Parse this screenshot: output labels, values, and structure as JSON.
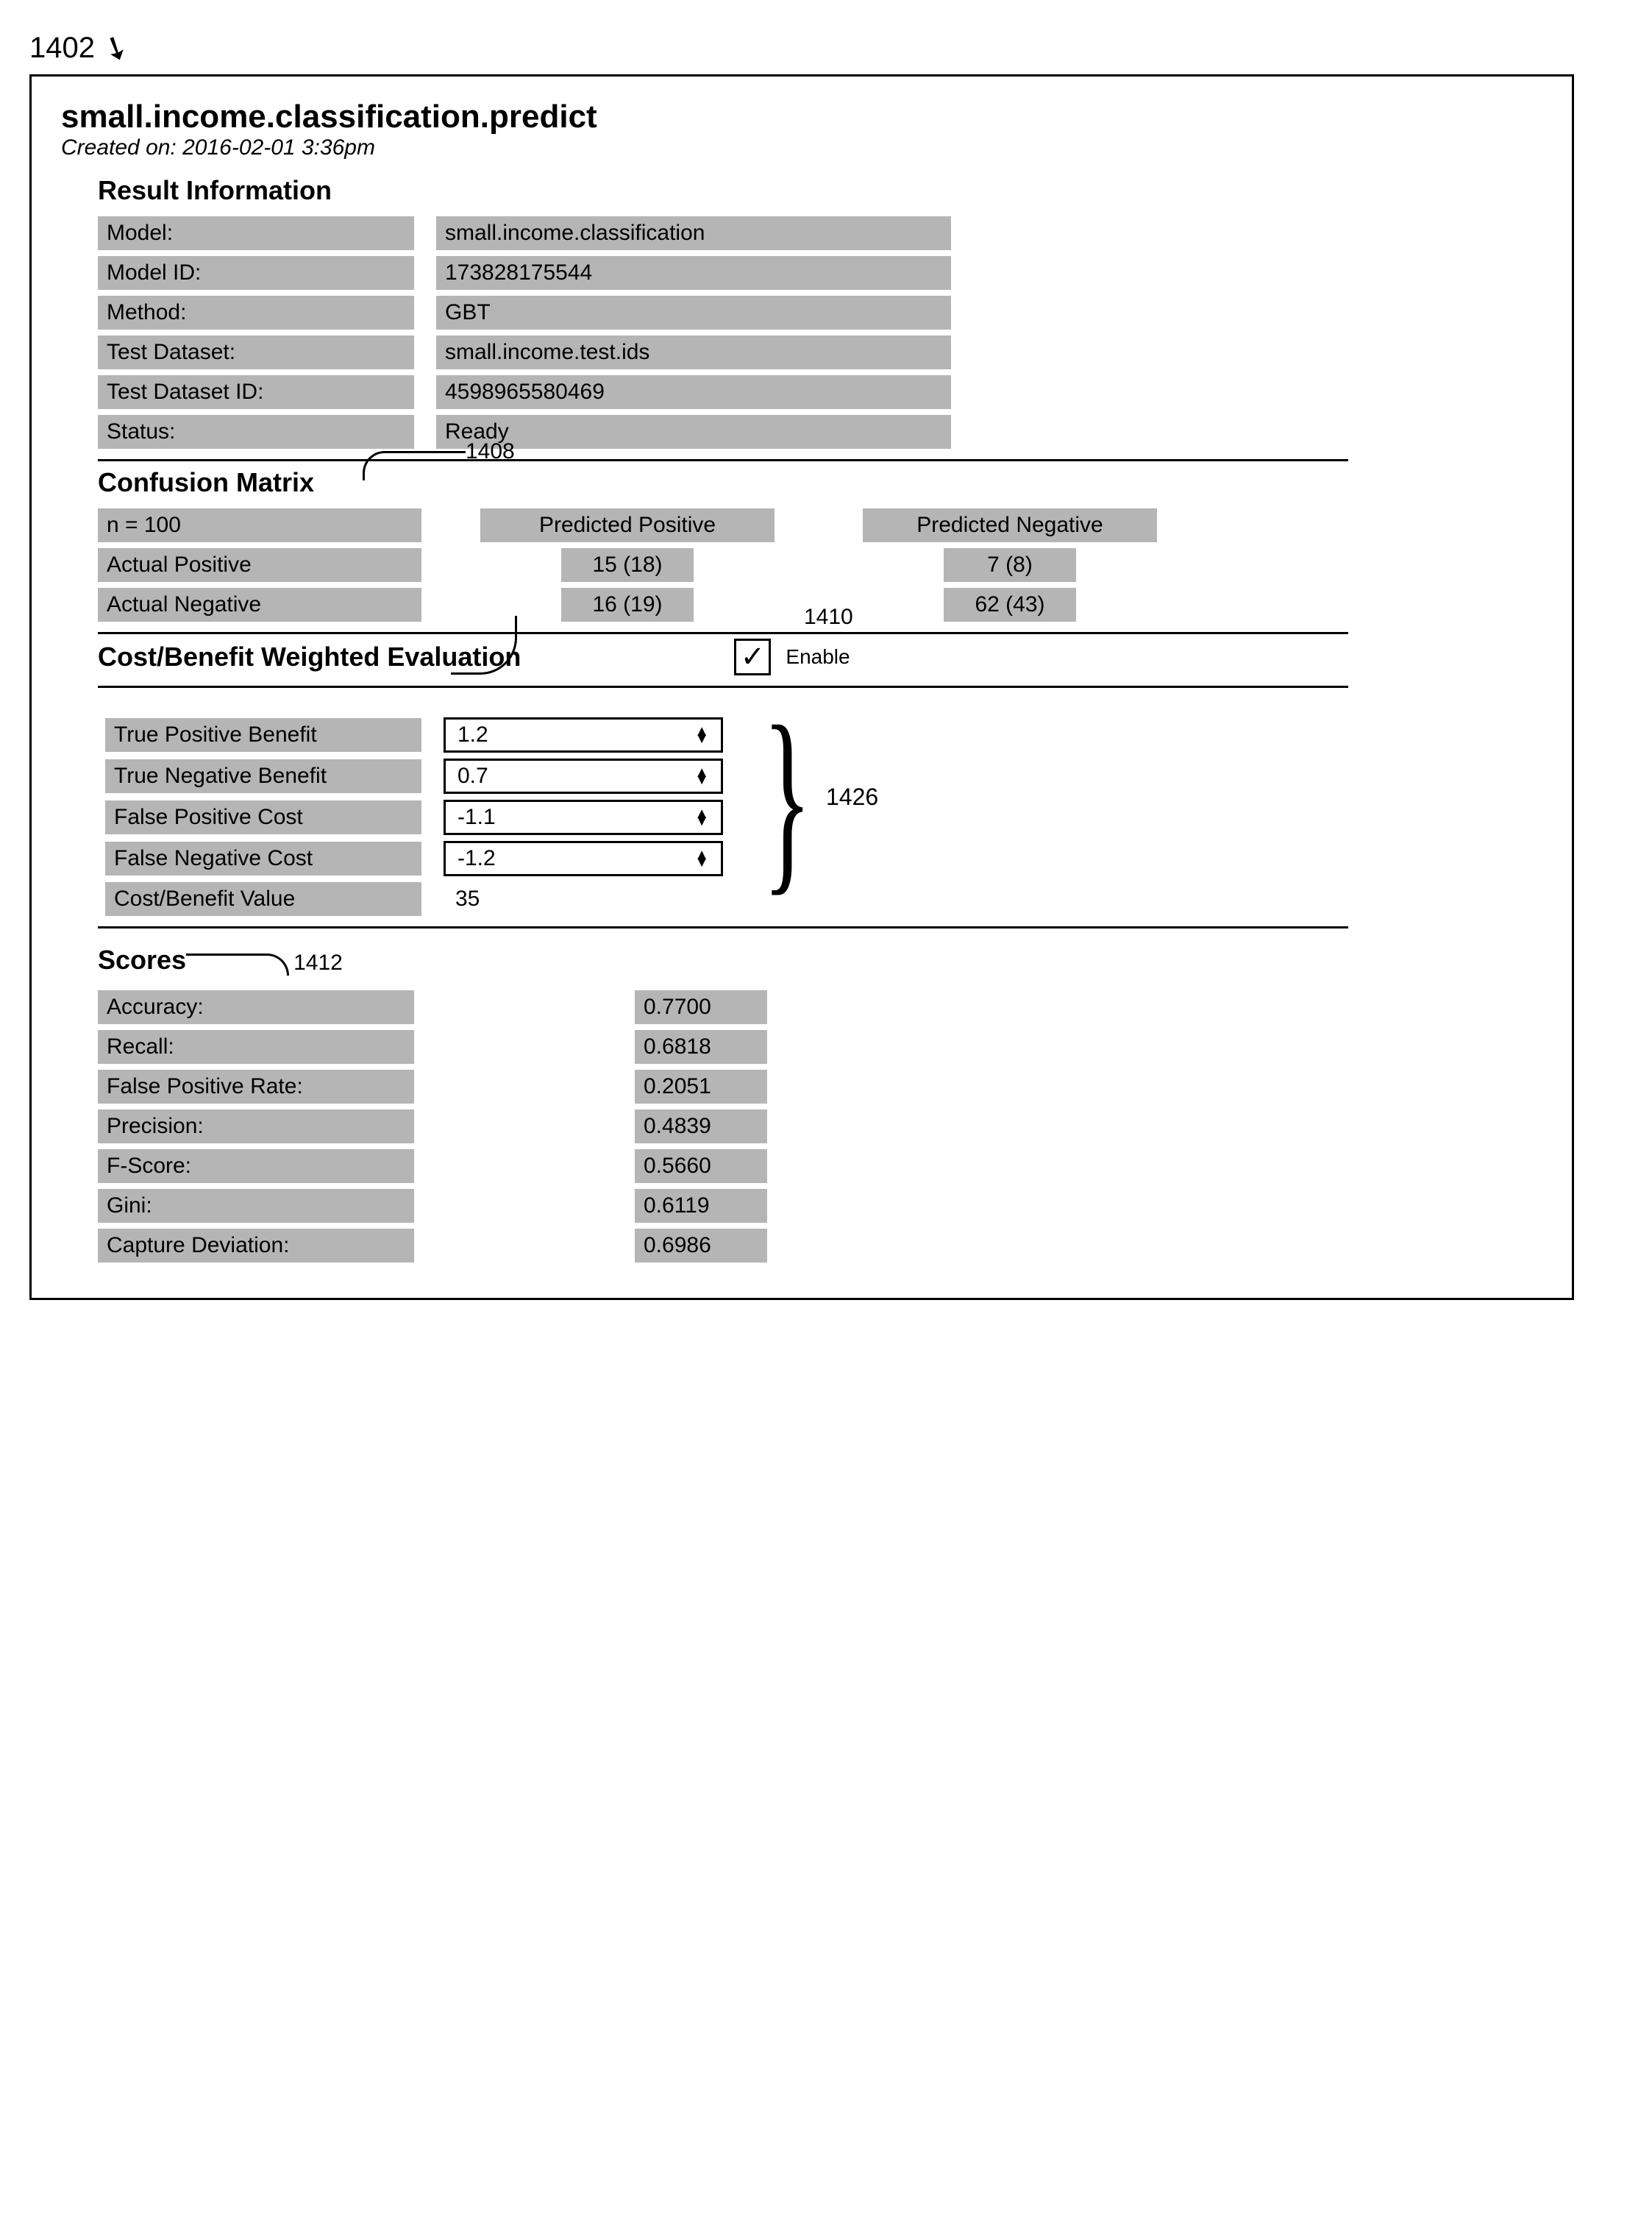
{
  "figure_ref": "1402",
  "header": {
    "title": "small.income.classification.predict",
    "created_label": "Created on:",
    "created_value": "2016-02-01 3:36pm"
  },
  "result_info": {
    "title": "Result Information",
    "rows": [
      {
        "label": "Model:",
        "value": "small.income.classification"
      },
      {
        "label": "Model ID:",
        "value": "173828175544"
      },
      {
        "label": "Method:",
        "value": "GBT"
      },
      {
        "label": "Test Dataset:",
        "value": "small.income.test.ids"
      },
      {
        "label": "Test Dataset ID:",
        "value": "4598965580469"
      },
      {
        "label": "Status:",
        "value": "Ready"
      }
    ]
  },
  "confusion_matrix": {
    "title": "Confusion Matrix",
    "callout": "1408",
    "n_label": "n = 100",
    "col_pos": "Predicted Positive",
    "col_neg": "Predicted Negative",
    "row_pos_label": "Actual Positive",
    "row_neg_label": "Actual Negative",
    "tp": "15 (18)",
    "fn": "7 (8)",
    "fp": "16 (19)",
    "tn": "62 (43)",
    "row_callout": "1410"
  },
  "cost_benefit": {
    "title": "Cost/Benefit Weighted Evaluation",
    "enable_label": "Enable",
    "enable_checked": true,
    "callout": "1426",
    "rows": [
      {
        "label": "True Positive Benefit",
        "value": "1.2"
      },
      {
        "label": "True Negative Benefit",
        "value": "0.7"
      },
      {
        "label": "False Positive Cost",
        "value": "-1.1"
      },
      {
        "label": "False Negative Cost",
        "value": "-1.2"
      }
    ],
    "result_label": "Cost/Benefit Value",
    "result_value": "35"
  },
  "scores": {
    "title": "Scores",
    "callout": "1412",
    "rows": [
      {
        "label": "Accuracy:",
        "value": "0.7700"
      },
      {
        "label": "Recall:",
        "value": "0.6818"
      },
      {
        "label": "False Positive Rate:",
        "value": "0.2051"
      },
      {
        "label": "Precision:",
        "value": "0.4839"
      },
      {
        "label": "F-Score:",
        "value": "0.5660"
      },
      {
        "label": "Gini:",
        "value": "0.6119"
      },
      {
        "label": "Capture Deviation:",
        "value": "0.6986"
      }
    ]
  }
}
